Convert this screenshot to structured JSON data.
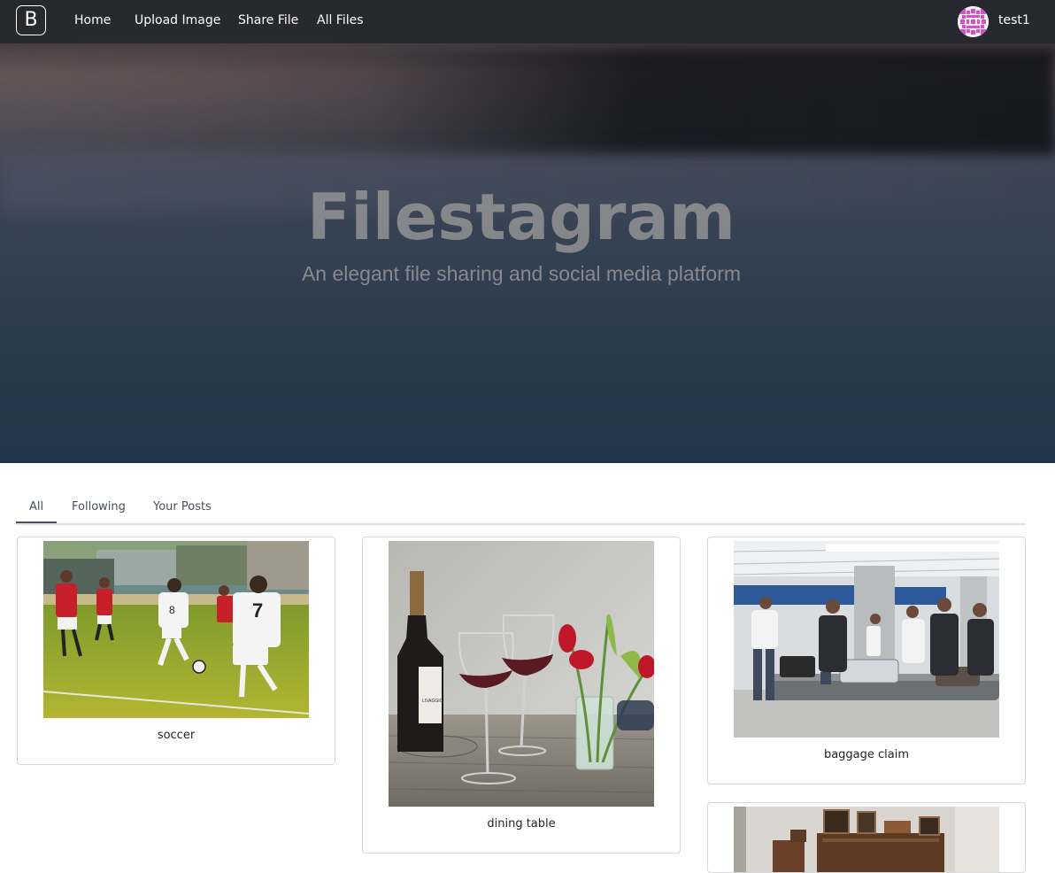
{
  "navbar": {
    "brand_letter": "B",
    "links": [
      "Home",
      "Upload Image",
      "Share File",
      "All Files"
    ],
    "username": "test1"
  },
  "hero": {
    "title": "Filestagram",
    "subtitle": "An elegant file sharing and social media platform"
  },
  "tabs": [
    "All",
    "Following",
    "Your Posts"
  ],
  "active_tab": "All",
  "posts": [
    {
      "caption": "soccer",
      "image": "soccer-photo"
    },
    {
      "caption": "dining table",
      "image": "wine-photo"
    },
    {
      "caption": "baggage claim",
      "image": "baggage-photo"
    },
    {
      "caption": "",
      "image": "shelf-photo"
    }
  ],
  "image_text": {
    "wine_label": "LIVAGGIO"
  }
}
